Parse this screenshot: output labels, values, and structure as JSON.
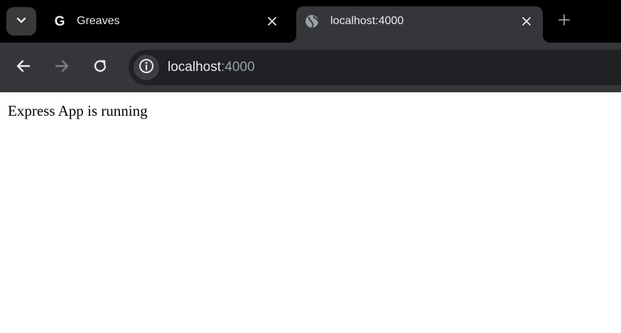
{
  "tabs": [
    {
      "title": "Greaves",
      "favicon": "google-g-icon",
      "active": false
    },
    {
      "title": "localhost:4000",
      "favicon": "globe-icon",
      "active": true
    }
  ],
  "omnibox": {
    "host": "localhost",
    "port": ":4000"
  },
  "page": {
    "text": "Express App is running"
  },
  "colors": {
    "tabstrip": "#000000",
    "toolbar": "#35363a",
    "omnibox": "#202124",
    "text_primary": "#e8eaed",
    "text_secondary": "#9aa0a6"
  }
}
